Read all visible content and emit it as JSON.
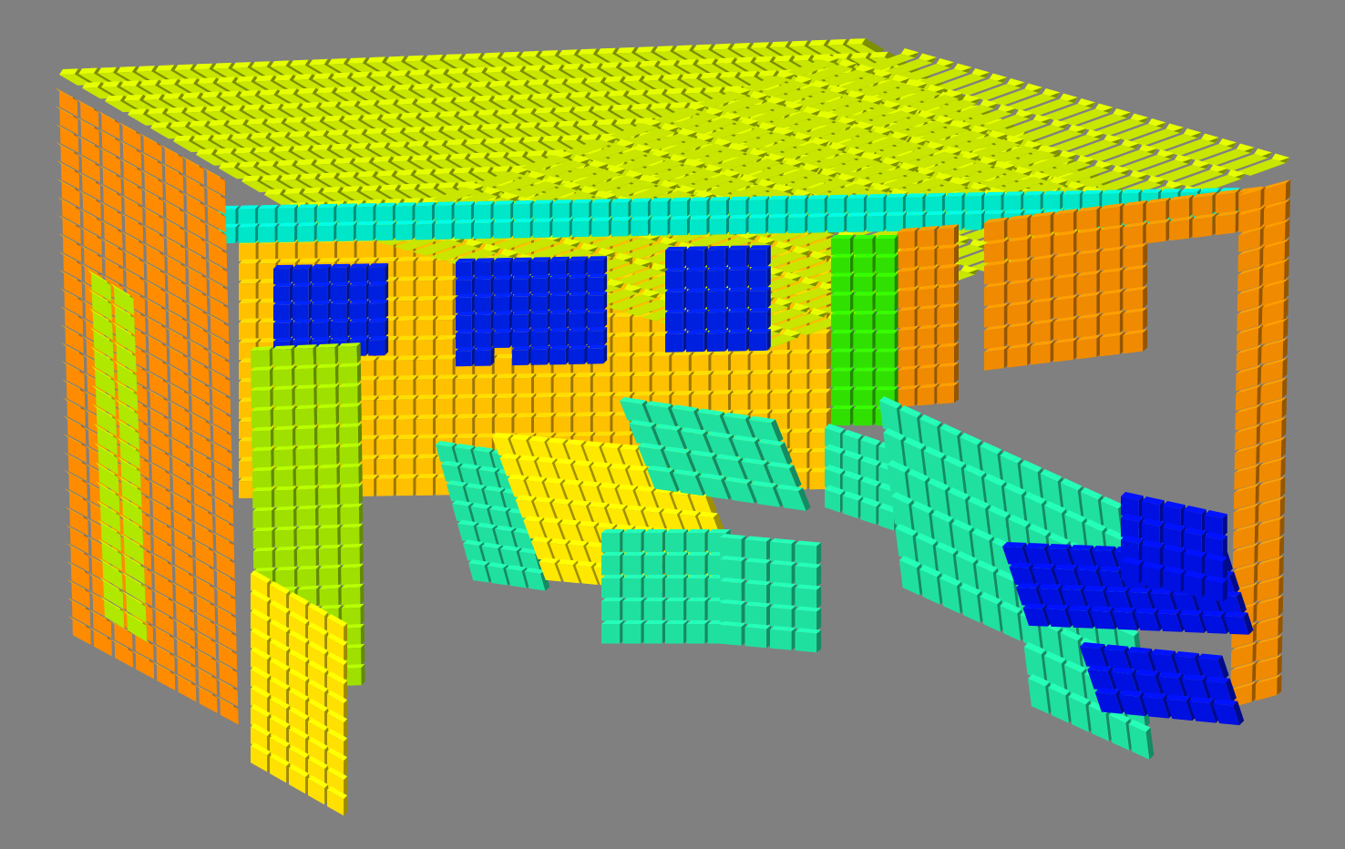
{
  "viewport": {
    "background_color": "#808080",
    "render_style": "voxel"
  },
  "palette": {
    "ceiling": "#c8e600",
    "ceiling_edge": "#00e6c8",
    "wall_back": "#ffc000",
    "wall_left": "#ff8c00",
    "wall_right": "#f08a00",
    "window": "#0020e0",
    "door": "#a0e000",
    "door_panel": "#ffe000",
    "pillar": "#30e000",
    "furniture": "#20e0a0",
    "table": "#ffe800",
    "chair_blue": "#0010e0",
    "mixed_green": "#b0e800"
  },
  "scene": {
    "objects": [
      {
        "name": "ceiling",
        "color_key": "ceiling"
      },
      {
        "name": "ceiling-edge",
        "color_key": "ceiling_edge"
      },
      {
        "name": "back-wall",
        "color_key": "wall_back"
      },
      {
        "name": "left-wall",
        "color_key": "wall_left"
      },
      {
        "name": "right-wall",
        "color_key": "wall_right"
      },
      {
        "name": "window-left",
        "color_key": "window"
      },
      {
        "name": "window-middle",
        "color_key": "window"
      },
      {
        "name": "window-right",
        "color_key": "window"
      },
      {
        "name": "door",
        "color_key": "door"
      },
      {
        "name": "door-panel",
        "color_key": "door_panel"
      },
      {
        "name": "pillar",
        "color_key": "pillar"
      },
      {
        "name": "table-left",
        "color_key": "table"
      },
      {
        "name": "chairs-left",
        "color_key": "furniture"
      },
      {
        "name": "bench-right",
        "color_key": "furniture"
      },
      {
        "name": "chairs-blue",
        "color_key": "chair_blue"
      }
    ]
  }
}
